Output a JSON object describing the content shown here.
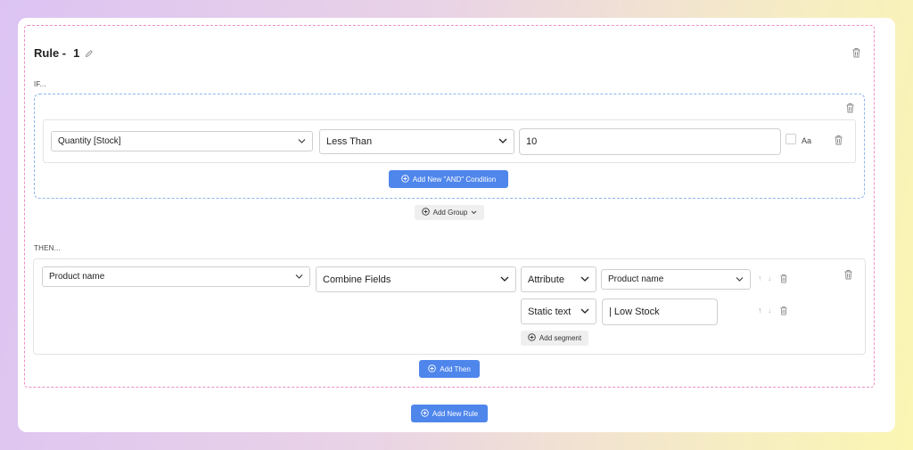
{
  "rule": {
    "title": "Rule -",
    "number": "1"
  },
  "if_label": "IF...",
  "condition": {
    "field": "Quantity [Stock]",
    "operator": "Less Than",
    "value": "10",
    "case_label": "Aa"
  },
  "add_and_condition_label": "Add New \"AND\" Condition",
  "add_group_label": "Add Group",
  "then_label": "THEN...",
  "action": {
    "target_field": "Product name",
    "action_type": "Combine Fields",
    "segments": [
      {
        "type": "Attribute",
        "value": "Product name"
      },
      {
        "type": "Static text",
        "value": "| Low Stock"
      }
    ],
    "add_segment_label": "Add segment"
  },
  "add_then_label": "Add Then",
  "add_new_rule_label": "Add New Rule",
  "colors": {
    "primary_button": "#4f86ec",
    "rule_border": "#ee8fc3",
    "group_border": "#8fb5ee"
  }
}
